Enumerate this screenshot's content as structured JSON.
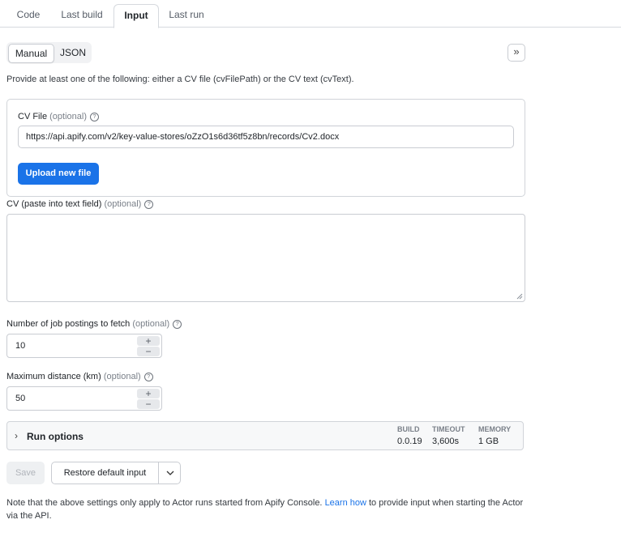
{
  "tabs": [
    {
      "label": "Code"
    },
    {
      "label": "Last build"
    },
    {
      "label": "Input",
      "active": true
    },
    {
      "label": "Last run"
    }
  ],
  "mode": {
    "manual": "Manual",
    "json": "JSON",
    "selected": "Manual"
  },
  "collapse_icon": "double-chevron-right-icon",
  "hint": "Provide at least one of the following: either a CV file (cvFilePath) or the CV text (cvText).",
  "cv_file": {
    "label": "CV File",
    "optional": "(optional)",
    "value": "https://api.apify.com/v2/key-value-stores/oZzO1s6d36tf5z8bn/records/Cv2.docx",
    "upload_label": "Upload new file"
  },
  "cv_text": {
    "label": "CV (paste into text field)",
    "optional": "(optional)",
    "value": ""
  },
  "job_postings": {
    "label": "Number of job postings to fetch",
    "optional": "(optional)",
    "value": "10"
  },
  "max_distance": {
    "label": "Maximum distance (km)",
    "optional": "(optional)",
    "value": "50"
  },
  "run_options": {
    "title": "Run options",
    "build_label": "BUILD",
    "build_value": "0.0.19",
    "timeout_label": "TIMEOUT",
    "timeout_value": "3,600s",
    "memory_label": "MEMORY",
    "memory_value": "1 GB"
  },
  "actions": {
    "save": "Save",
    "restore": "Restore default input"
  },
  "note": {
    "before": "Note that the above settings only apply to Actor runs started from Apify Console.",
    "link": "Learn how",
    "after": "to provide input when starting the Actor via the API."
  },
  "colors": {
    "primary": "#1a73e8",
    "border": "#c9ccd2"
  }
}
